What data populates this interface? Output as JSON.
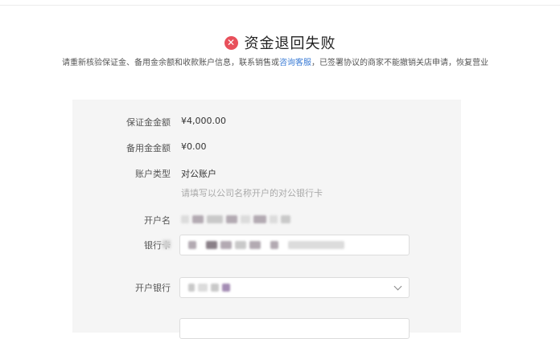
{
  "header": {
    "icon": "close-circle-icon",
    "title": "资金退回失败"
  },
  "notice": {
    "text_before": "请重新核验保证金、备用金余额和收款账户信息，联系销售或",
    "link": "咨询客服",
    "text_after": "，已签署协议的商家不能撤销关店申请，恢复营业"
  },
  "form": {
    "deposit": {
      "label": "保证金金额",
      "value": "¥4,000.00"
    },
    "reserve": {
      "label": "备用金金额",
      "value": "¥0.00"
    },
    "account_type": {
      "label": "账户类型",
      "value": "对公账户",
      "hint": "请填写以公司名称开户的对公银行卡"
    },
    "account_name": {
      "label": "开户名"
    },
    "bank_card": {
      "label": "银行卡"
    },
    "bank": {
      "label": "开户银行"
    }
  },
  "colors": {
    "fail": "#e8505b",
    "link": "#3a7bd5",
    "panel": "#f5f5f5"
  }
}
